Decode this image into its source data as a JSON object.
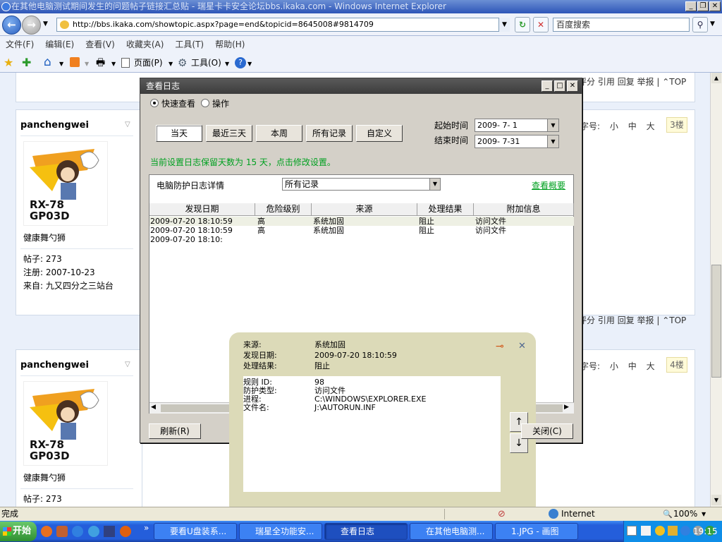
{
  "window": {
    "title": "在其他电脑测试期间发生的问题帖子链接汇总贴 - 瑞星卡卡安全论坛bbs.ikaka.com - Windows Internet Explorer"
  },
  "address": {
    "url": "http://bbs.ikaka.com/showtopic.aspx?page=end&topicid=8645008#9814709",
    "search_placeholder": "百度搜索"
  },
  "menu": [
    "文件(F)",
    "编辑(E)",
    "查看(V)",
    "收藏夹(A)",
    "工具(T)",
    "帮助(H)"
  ],
  "favbar": {
    "page": "页面(P)",
    "tools": "工具(O)"
  },
  "post_links": {
    "rate": "评分",
    "quote": "引用",
    "reply": "回复",
    "report": "举报",
    "top": "TOP"
  },
  "font_size": {
    "label": "字号:",
    "small": "小",
    "medium": "中",
    "large": "大"
  },
  "posts": [
    {
      "user": "panchengwei",
      "title": "健康舞勺狮",
      "posts_label": "帖子:",
      "posts": "273",
      "reg_label": "注册:",
      "reg": "2007-10-23",
      "from_label": "来自:",
      "from": "九又四分之三站台",
      "floor": "3楼"
    },
    {
      "user": "panchengwei",
      "title": "健康舞勺狮",
      "posts_label": "帖子:",
      "posts": "273",
      "floor": "4楼"
    }
  ],
  "dialog": {
    "title": "查看日志",
    "mode_quick": "快速查看",
    "mode_op": "操作",
    "tabs": [
      "当天",
      "最近三天",
      "本周",
      "所有记录",
      "自定义"
    ],
    "start_label": "起始时间",
    "start_value": "2009- 7- 1",
    "end_label": "结束时间",
    "end_value": "2009- 7-31",
    "retention_note": "当前设置日志保留天数为 15 天，点击修改设置。",
    "log_type_label": "电脑防护日志详情",
    "filter_value": "所有记录",
    "summary_link": "查看概要",
    "columns": [
      "发现日期",
      "危险级别",
      "来源",
      "处理结果",
      "附加信息"
    ],
    "rows": [
      [
        "2009-07-20 18:10:59",
        "高",
        "系统加固",
        "阻止",
        "访问文件"
      ],
      [
        "2009-07-20 18:10:59",
        "高",
        "系统加固",
        "阻止",
        "访问文件"
      ],
      [
        "2009-07-20 18:10:",
        "",
        "",
        "",
        ""
      ]
    ],
    "refresh": "刷新(R)",
    "close": "关闭(C)"
  },
  "popup": {
    "source_label": "来源:",
    "source": "系统加固",
    "date_label": "发现日期:",
    "date": "2009-07-20 18:10:59",
    "result_label": "处理结果:",
    "result": "阻止",
    "details": [
      {
        "k": "规则 ID:",
        "v": "98"
      },
      {
        "k": "防护类型:",
        "v": "访问文件"
      },
      {
        "k": "进程:",
        "v": "C:\\WINDOWS\\EXPLORER.EXE"
      },
      {
        "k": "文件名:",
        "v": "J:\\AUTORUN.INF"
      }
    ]
  },
  "statusbar": {
    "left": "完成",
    "zone": "Internet",
    "zoom": "100%"
  },
  "taskbar": {
    "start": "开始",
    "tasks": [
      "要看U盘装系...",
      "瑞星全功能安...",
      "查看日志",
      "在其他电脑测...",
      "1.JPG - 画图"
    ],
    "clock": "19:15"
  },
  "colors": {
    "green_text": "#00a020",
    "title_blue": "#2d55b8",
    "dialog_grey": "#d4d0c8",
    "popup_bg": "#dcdab8"
  }
}
